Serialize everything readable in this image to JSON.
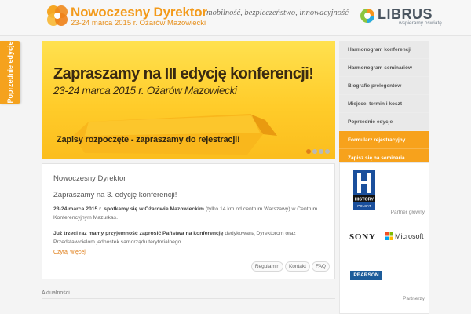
{
  "header": {
    "site_title": "Nowoczesny Dyrektor",
    "site_subtitle": "23-24 marca 2015 r. Ożarów Mazowiecki",
    "tagline": "mobilność, bezpieczeństwo, innowacyjność",
    "sponsor_name": "LIBRUS",
    "sponsor_tagline": "wspieramy oświatę"
  },
  "side_tab": {
    "label": "Poprzednie edycje"
  },
  "banner": {
    "title": "Zapraszamy na III edycję konferencji!",
    "date": "23-24 marca 2015 r. Ożarów Mazowiecki",
    "ribbon": "Zapisy rozpoczęte - zapraszamy do rejestracji!",
    "slide_count": 4,
    "active_slide": 1
  },
  "menu": {
    "items": [
      {
        "label": "Harmonogram konferencji"
      },
      {
        "label": "Harmonogram seminariów"
      },
      {
        "label": "Biografie prelegentów"
      },
      {
        "label": "Miejsce, termin i koszt"
      },
      {
        "label": "Poprzednie edycje"
      },
      {
        "label": "Formularz rejestracyjny"
      },
      {
        "label": "Zapisz się na seminaria"
      }
    ]
  },
  "content": {
    "title": "Nowoczesny Dyrektor",
    "subtitle": "Zapraszamy na 3. edycję konferencji!",
    "p1_bold": "23-24 marca 2015 r. spotkamy się w Ożarowie Mazowieckim",
    "p1_rest": " (tylko 14 km od centrum Warszawy) w Centrum Konferencyjnym Mazurkas.",
    "p2_bold": "Już trzeci raz mamy przyjemność zaprosić Państwa na konferencję",
    "p2_rest": " dedykowaną Dyrektorom oraz Przedstawicielom jednostek samorządu terytorialnego.",
    "more_link": "Czytaj więcej",
    "links": [
      "Regulamin",
      "Kontakt",
      "FAQ"
    ]
  },
  "news": {
    "label": "Aktualności"
  },
  "partners": {
    "main_label": "Partner główny",
    "main_logo_text": "HISTORY",
    "main_logo_sub": "POLSAT",
    "partners_label": "Partnerzy",
    "logos": [
      "SONY",
      "Microsoft",
      "PEARSON"
    ]
  },
  "colors": {
    "accent": "#f7a21c",
    "banner": "#ffd232",
    "text": "#555555"
  }
}
